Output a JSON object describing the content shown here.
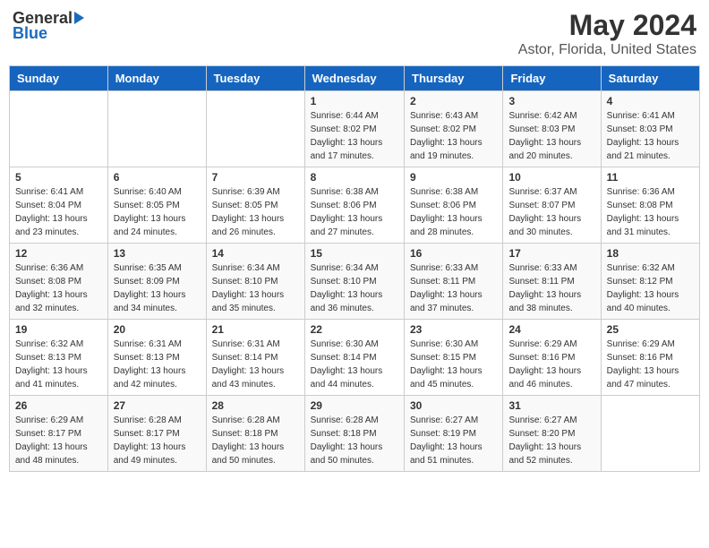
{
  "logo": {
    "general": "General",
    "blue": "Blue",
    "arrow": "▶"
  },
  "title": "May 2024",
  "subtitle": "Astor, Florida, United States",
  "days": [
    "Sunday",
    "Monday",
    "Tuesday",
    "Wednesday",
    "Thursday",
    "Friday",
    "Saturday"
  ],
  "weeks": [
    [
      {
        "date": "",
        "sunrise": "",
        "sunset": "",
        "daylight": ""
      },
      {
        "date": "",
        "sunrise": "",
        "sunset": "",
        "daylight": ""
      },
      {
        "date": "",
        "sunrise": "",
        "sunset": "",
        "daylight": ""
      },
      {
        "date": "1",
        "sunrise": "Sunrise: 6:44 AM",
        "sunset": "Sunset: 8:02 PM",
        "daylight": "Daylight: 13 hours and 17 minutes."
      },
      {
        "date": "2",
        "sunrise": "Sunrise: 6:43 AM",
        "sunset": "Sunset: 8:02 PM",
        "daylight": "Daylight: 13 hours and 19 minutes."
      },
      {
        "date": "3",
        "sunrise": "Sunrise: 6:42 AM",
        "sunset": "Sunset: 8:03 PM",
        "daylight": "Daylight: 13 hours and 20 minutes."
      },
      {
        "date": "4",
        "sunrise": "Sunrise: 6:41 AM",
        "sunset": "Sunset: 8:03 PM",
        "daylight": "Daylight: 13 hours and 21 minutes."
      }
    ],
    [
      {
        "date": "5",
        "sunrise": "Sunrise: 6:41 AM",
        "sunset": "Sunset: 8:04 PM",
        "daylight": "Daylight: 13 hours and 23 minutes."
      },
      {
        "date": "6",
        "sunrise": "Sunrise: 6:40 AM",
        "sunset": "Sunset: 8:05 PM",
        "daylight": "Daylight: 13 hours and 24 minutes."
      },
      {
        "date": "7",
        "sunrise": "Sunrise: 6:39 AM",
        "sunset": "Sunset: 8:05 PM",
        "daylight": "Daylight: 13 hours and 26 minutes."
      },
      {
        "date": "8",
        "sunrise": "Sunrise: 6:38 AM",
        "sunset": "Sunset: 8:06 PM",
        "daylight": "Daylight: 13 hours and 27 minutes."
      },
      {
        "date": "9",
        "sunrise": "Sunrise: 6:38 AM",
        "sunset": "Sunset: 8:06 PM",
        "daylight": "Daylight: 13 hours and 28 minutes."
      },
      {
        "date": "10",
        "sunrise": "Sunrise: 6:37 AM",
        "sunset": "Sunset: 8:07 PM",
        "daylight": "Daylight: 13 hours and 30 minutes."
      },
      {
        "date": "11",
        "sunrise": "Sunrise: 6:36 AM",
        "sunset": "Sunset: 8:08 PM",
        "daylight": "Daylight: 13 hours and 31 minutes."
      }
    ],
    [
      {
        "date": "12",
        "sunrise": "Sunrise: 6:36 AM",
        "sunset": "Sunset: 8:08 PM",
        "daylight": "Daylight: 13 hours and 32 minutes."
      },
      {
        "date": "13",
        "sunrise": "Sunrise: 6:35 AM",
        "sunset": "Sunset: 8:09 PM",
        "daylight": "Daylight: 13 hours and 34 minutes."
      },
      {
        "date": "14",
        "sunrise": "Sunrise: 6:34 AM",
        "sunset": "Sunset: 8:10 PM",
        "daylight": "Daylight: 13 hours and 35 minutes."
      },
      {
        "date": "15",
        "sunrise": "Sunrise: 6:34 AM",
        "sunset": "Sunset: 8:10 PM",
        "daylight": "Daylight: 13 hours and 36 minutes."
      },
      {
        "date": "16",
        "sunrise": "Sunrise: 6:33 AM",
        "sunset": "Sunset: 8:11 PM",
        "daylight": "Daylight: 13 hours and 37 minutes."
      },
      {
        "date": "17",
        "sunrise": "Sunrise: 6:33 AM",
        "sunset": "Sunset: 8:11 PM",
        "daylight": "Daylight: 13 hours and 38 minutes."
      },
      {
        "date": "18",
        "sunrise": "Sunrise: 6:32 AM",
        "sunset": "Sunset: 8:12 PM",
        "daylight": "Daylight: 13 hours and 40 minutes."
      }
    ],
    [
      {
        "date": "19",
        "sunrise": "Sunrise: 6:32 AM",
        "sunset": "Sunset: 8:13 PM",
        "daylight": "Daylight: 13 hours and 41 minutes."
      },
      {
        "date": "20",
        "sunrise": "Sunrise: 6:31 AM",
        "sunset": "Sunset: 8:13 PM",
        "daylight": "Daylight: 13 hours and 42 minutes."
      },
      {
        "date": "21",
        "sunrise": "Sunrise: 6:31 AM",
        "sunset": "Sunset: 8:14 PM",
        "daylight": "Daylight: 13 hours and 43 minutes."
      },
      {
        "date": "22",
        "sunrise": "Sunrise: 6:30 AM",
        "sunset": "Sunset: 8:14 PM",
        "daylight": "Daylight: 13 hours and 44 minutes."
      },
      {
        "date": "23",
        "sunrise": "Sunrise: 6:30 AM",
        "sunset": "Sunset: 8:15 PM",
        "daylight": "Daylight: 13 hours and 45 minutes."
      },
      {
        "date": "24",
        "sunrise": "Sunrise: 6:29 AM",
        "sunset": "Sunset: 8:16 PM",
        "daylight": "Daylight: 13 hours and 46 minutes."
      },
      {
        "date": "25",
        "sunrise": "Sunrise: 6:29 AM",
        "sunset": "Sunset: 8:16 PM",
        "daylight": "Daylight: 13 hours and 47 minutes."
      }
    ],
    [
      {
        "date": "26",
        "sunrise": "Sunrise: 6:29 AM",
        "sunset": "Sunset: 8:17 PM",
        "daylight": "Daylight: 13 hours and 48 minutes."
      },
      {
        "date": "27",
        "sunrise": "Sunrise: 6:28 AM",
        "sunset": "Sunset: 8:17 PM",
        "daylight": "Daylight: 13 hours and 49 minutes."
      },
      {
        "date": "28",
        "sunrise": "Sunrise: 6:28 AM",
        "sunset": "Sunset: 8:18 PM",
        "daylight": "Daylight: 13 hours and 50 minutes."
      },
      {
        "date": "29",
        "sunrise": "Sunrise: 6:28 AM",
        "sunset": "Sunset: 8:18 PM",
        "daylight": "Daylight: 13 hours and 50 minutes."
      },
      {
        "date": "30",
        "sunrise": "Sunrise: 6:27 AM",
        "sunset": "Sunset: 8:19 PM",
        "daylight": "Daylight: 13 hours and 51 minutes."
      },
      {
        "date": "31",
        "sunrise": "Sunrise: 6:27 AM",
        "sunset": "Sunset: 8:20 PM",
        "daylight": "Daylight: 13 hours and 52 minutes."
      },
      {
        "date": "",
        "sunrise": "",
        "sunset": "",
        "daylight": ""
      }
    ]
  ]
}
